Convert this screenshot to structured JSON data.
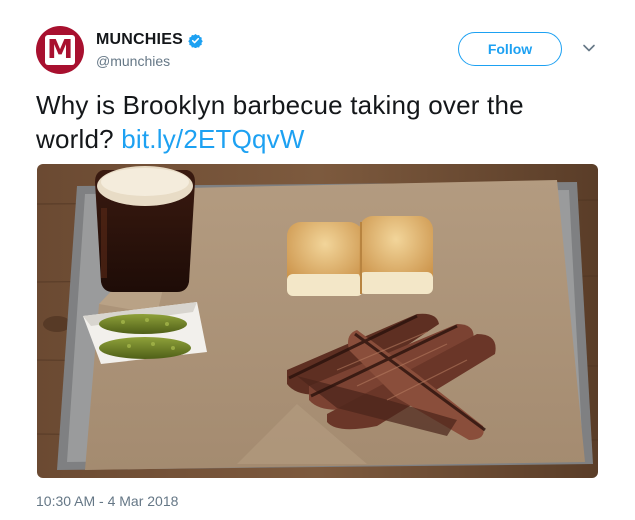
{
  "user": {
    "display_name": "MUNCHIES",
    "handle": "@munchies",
    "avatar_letter": "M",
    "verified": true
  },
  "follow_label": "Follow",
  "tweet": {
    "text": "Why is Brooklyn barbecue taking over the world?",
    "link": "bit.ly/2ETQqvW"
  },
  "timestamp": "10:30 AM - 4 Mar 2018",
  "icons": {
    "verified": "verified-badge-icon",
    "more": "chevron-down-icon"
  },
  "colors": {
    "brand": "#a8102f",
    "accent": "#1da1f2",
    "text": "#14171a",
    "muted": "#657786"
  }
}
